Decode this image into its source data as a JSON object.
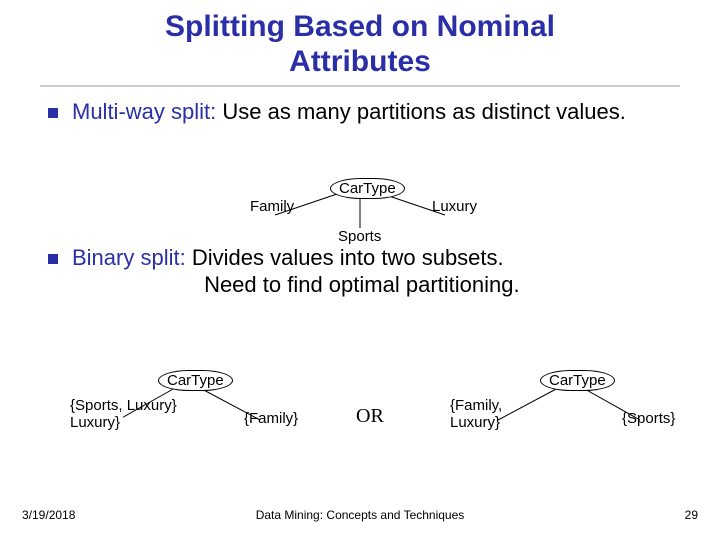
{
  "title_line1": "Splitting Based on Nominal",
  "title_line2": "Attributes",
  "bullets": {
    "multi_term": "Multi-way split:",
    "multi_rest": " Use as many partitions as distinct values.",
    "binary_term": "Binary split:",
    "binary_rest_l1": "  Divides values into two subsets.",
    "binary_rest_l2": "Need to find optimal partitioning."
  },
  "multiway": {
    "node": "CarType",
    "left": "Family",
    "mid": "Sports",
    "right": "Luxury"
  },
  "binary": {
    "left_tree": {
      "node": "CarType",
      "left": "{Sports, Luxury}",
      "right": "{Family}"
    },
    "or": "OR",
    "right_tree": {
      "node": "CarType",
      "left": "{Family, Luxury}",
      "right": "{Sports}"
    }
  },
  "footer": {
    "date": "3/19/2018",
    "center": "Data Mining: Concepts and Techniques",
    "page": "29"
  }
}
